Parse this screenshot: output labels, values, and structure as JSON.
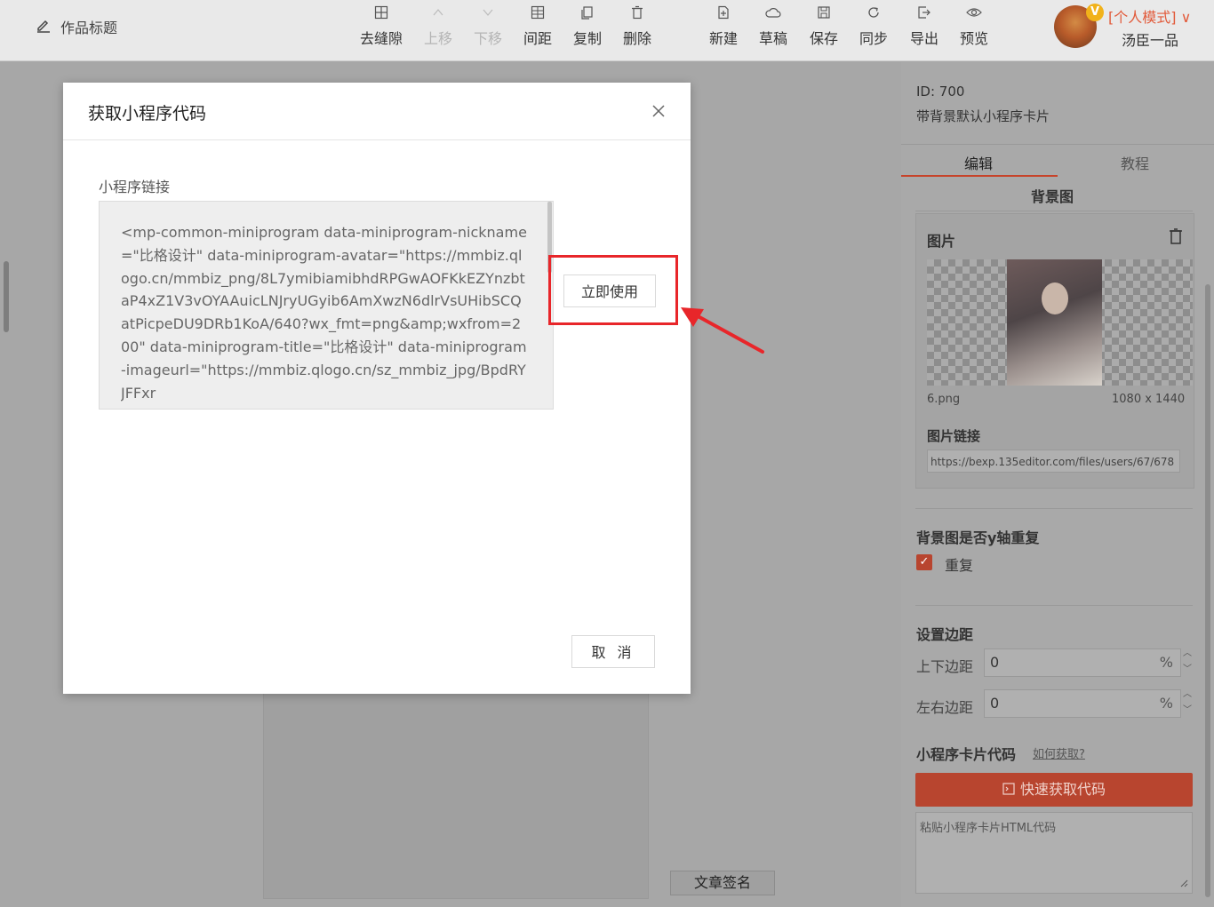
{
  "topbar": {
    "work_title": "作品标题",
    "tools": [
      {
        "label": "去缝隙",
        "icon": "grid-icon",
        "disabled": false
      },
      {
        "label": "上移",
        "icon": "chevron-up-icon",
        "disabled": true
      },
      {
        "label": "下移",
        "icon": "chevron-down-icon",
        "disabled": true
      },
      {
        "label": "间距",
        "icon": "spacing-icon",
        "disabled": false
      },
      {
        "label": "复制",
        "icon": "copy-icon",
        "disabled": false
      },
      {
        "label": "删除",
        "icon": "trash-icon",
        "disabled": false
      },
      {
        "label": "新建",
        "icon": "new-file-icon",
        "disabled": false
      },
      {
        "label": "草稿",
        "icon": "cloud-icon",
        "disabled": false
      },
      {
        "label": "保存",
        "icon": "save-icon",
        "disabled": false
      },
      {
        "label": "同步",
        "icon": "sync-icon",
        "disabled": false
      },
      {
        "label": "导出",
        "icon": "export-icon",
        "disabled": false
      },
      {
        "label": "预览",
        "icon": "eye-icon",
        "disabled": false
      }
    ],
    "vip_badge": "V",
    "mode": "[个人模式]",
    "mode_arrow": "∨",
    "username": "汤臣一品"
  },
  "canvas": {
    "sign_button": "文章签名"
  },
  "right_panel": {
    "id_line": "ID: 700",
    "template_name": "带背景默认小程序卡片",
    "tabs": [
      "编辑",
      "教程"
    ],
    "bg_section_title": "背景图",
    "image_label": "图片",
    "image_filename": "6.png",
    "image_dimensions": "1080 x 1440",
    "image_link_label": "图片链接",
    "image_link_value": "https://bexp.135editor.com/files/users/67/678",
    "repeat_title": "背景图是否y轴重复",
    "repeat_label": "重复",
    "repeat_checked": true,
    "margin_title": "设置边距",
    "vertical_margin_label": "上下边距",
    "vertical_margin_value": "0",
    "horizontal_margin_label": "左右边距",
    "horizontal_margin_value": "0",
    "unit": "%",
    "card_code_title": "小程序卡片代码",
    "how_to_link": "如何获取?",
    "quick_button": "快速获取代码",
    "paste_placeholder": "粘贴小程序卡片HTML代码",
    "accent_color": "#b8452f"
  },
  "modal": {
    "title": "获取小程序代码",
    "close_icon": "×",
    "field_label": "小程序链接",
    "code_value": "<mp-common-miniprogram data-miniprogram-nickname=\"比格设计\" data-miniprogram-avatar=\"https://mmbiz.qlogo.cn/mmbiz_png/8L7ymibiamibhdRPGwAOFKkEZYnzbtaP4xZ1V3vOYAAuicLNJryUGyib6AmXwzN6dlrVsUHibSCQatPicpeDU9DRb1KoA/640?wx_fmt=png&amp;wxfrom=200\" data-miniprogram-title=\"比格设计\" data-miniprogram-imageurl=\"https://mmbiz.qlogo.cn/sz_mmbiz_jpg/BpdRYJFFxr",
    "use_button": "立即使用",
    "cancel_button": "取 消",
    "highlight_color": "#e8262a"
  }
}
